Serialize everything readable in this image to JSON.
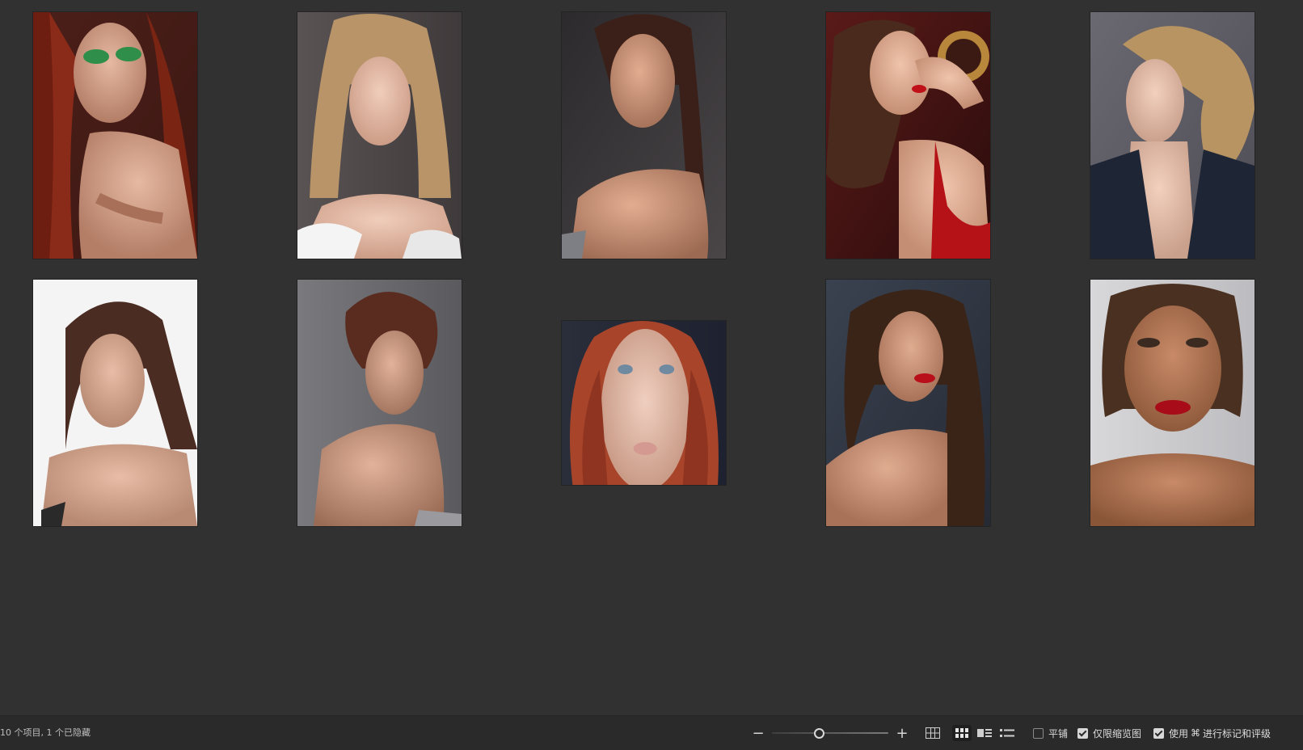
{
  "browser": {
    "thumbnails": [
      {
        "name": "thumb-1",
        "orientation": "portrait",
        "description": "redhead-green-eyeshadow"
      },
      {
        "name": "thumb-2",
        "orientation": "portrait",
        "description": "blonde-white-top"
      },
      {
        "name": "thumb-3",
        "orientation": "portrait",
        "description": "brunette-bare-shoulder"
      },
      {
        "name": "thumb-4",
        "orientation": "portrait",
        "description": "curly-red-lips-red-dress"
      },
      {
        "name": "thumb-5",
        "orientation": "portrait",
        "description": "curly-updo-blazer"
      },
      {
        "name": "thumb-6",
        "orientation": "portrait",
        "description": "brunette-white-background"
      },
      {
        "name": "thumb-7",
        "orientation": "portrait",
        "description": "updo-bare-shoulder"
      },
      {
        "name": "thumb-8",
        "orientation": "landscape",
        "description": "redhead-closeup"
      },
      {
        "name": "thumb-9",
        "orientation": "portrait",
        "description": "wavy-hair-red-lips"
      },
      {
        "name": "thumb-10",
        "orientation": "portrait",
        "description": "slicked-hair-red-lips"
      }
    ]
  },
  "statusbar": {
    "item_count": "10 个项目, 1 个已隐藏",
    "zoom": {
      "minus_icon": "minus-icon",
      "plus_icon": "plus-icon",
      "level": 0.4
    },
    "view_modes": [
      {
        "icon": "grid-small-icon",
        "active": false
      },
      {
        "icon": "grid-large-icon",
        "active": true
      },
      {
        "icon": "filmstrip-icon",
        "active": false
      },
      {
        "icon": "list-icon",
        "active": false
      }
    ],
    "tile_label": "平铺",
    "tile_checked": false,
    "thumbs_only_label": "仅限缩览图",
    "thumbs_only_checked": true,
    "use_label": "使用",
    "cmd_symbol": "⌘",
    "use_suffix": "进行标记和评级",
    "use_checked": true
  }
}
